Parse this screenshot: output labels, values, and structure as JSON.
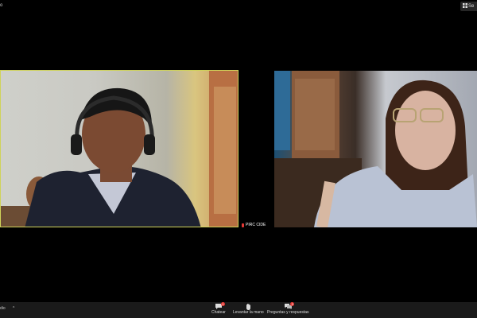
{
  "top": {
    "left_text": "o",
    "view_label": "Se"
  },
  "participants": {
    "right_name": "PIRC CIDE"
  },
  "toolbar": {
    "audio_label": "dio",
    "chat_label": "Chatear",
    "chat_badge": "1",
    "raise_hand_label": "Levantar la mano",
    "qa_label": "Preguntas y respuestas",
    "qa_badge": "3"
  }
}
